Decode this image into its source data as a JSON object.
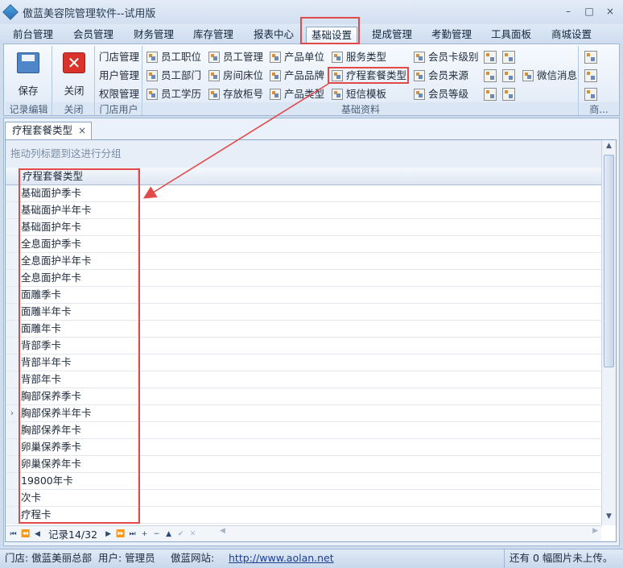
{
  "app": {
    "title": "傲蓝美容院管理软件--试用版"
  },
  "window": {
    "minimize": "–",
    "restore": "□",
    "close": "×"
  },
  "menu": [
    "前台管理",
    "会员管理",
    "财务管理",
    "库存管理",
    "报表中心",
    "基础设置",
    "提成管理",
    "考勤管理",
    "工具面板",
    "商城设置"
  ],
  "ribbon": {
    "save": "保存",
    "close": "关闭",
    "group_records": "记录编辑",
    "group_close": "关闭",
    "store_items": [
      "门店管理",
      "用户管理",
      "权限管理"
    ],
    "group_store": "门店用户",
    "col1": [
      "员工职位",
      "员工部门",
      "员工学历"
    ],
    "col2": [
      "员工管理",
      "房间床位",
      "存放柜号"
    ],
    "col3": [
      "产品单位",
      "产品品牌",
      "产品类型"
    ],
    "col4": [
      "服务类型",
      "疗程套餐类型",
      "短信模板"
    ],
    "col5": [
      "会员卡级别",
      "会员来源",
      "会员等级"
    ],
    "wechat": "微信消息",
    "group_basic": "基础资料",
    "group_mall": "商..."
  },
  "doc_tab": {
    "title": "疗程套餐类型",
    "close": "×"
  },
  "grid": {
    "group_hint": "拖动列标题到这进行分组",
    "column_header": "疗程套餐类型",
    "rows": [
      "基础面护季卡",
      "基础面护半年卡",
      "基础面护年卡",
      "全息面护季卡",
      "全息面护半年卡",
      "全息面护年卡",
      "面雕季卡",
      "面雕半年卡",
      "面雕年卡",
      "背部季卡",
      "背部半年卡",
      "背部年卡",
      "胸部保养季卡",
      "胸部保养半年卡",
      "胸部保养年卡",
      "卵巢保养季卡",
      "卵巢保养年卡",
      "19800年卡",
      "次卡",
      "疗程卡"
    ],
    "current_row_marker": "›",
    "record_label": "记录14/32"
  },
  "status": {
    "store": "门店: 傲蓝美丽总部",
    "user": "用户: 管理员",
    "site_label": "傲蓝网站:",
    "site_url": "http://www.aolan.net",
    "upload": "还有 0 幅图片未上传。"
  }
}
